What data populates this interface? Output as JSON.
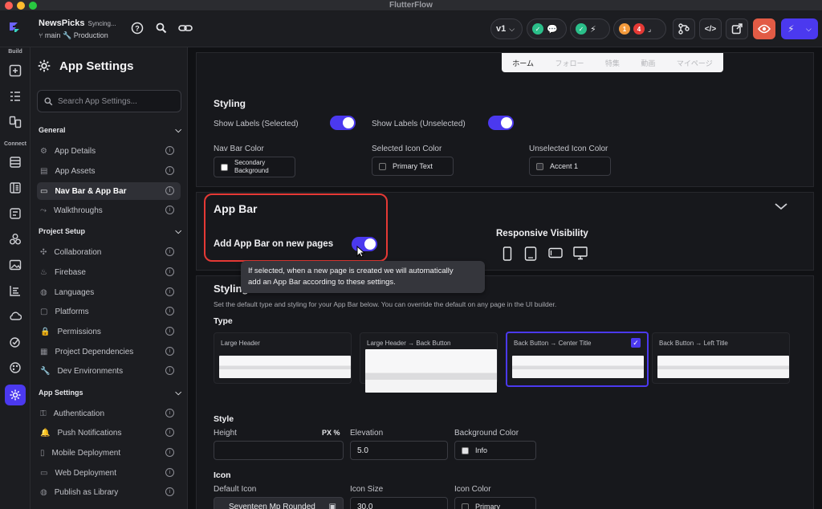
{
  "window": {
    "title": "FlutterFlow",
    "dots": [
      "#ff5f57",
      "#febc2e",
      "#28c840"
    ]
  },
  "topbar": {
    "project_name": "NewsPicks",
    "sync_status": "Syncing...",
    "branch": "main",
    "environment": "Production",
    "version": "v1",
    "warnings_count": "1",
    "errors_count": "4"
  },
  "rail": {
    "build_label": "Build",
    "connect_label": "Connect"
  },
  "settings": {
    "title": "App Settings",
    "search_placeholder": "Search App Settings...",
    "groups": [
      {
        "label": "General",
        "items": [
          "App Details",
          "App Assets",
          "Nav Bar & App Bar",
          "Walkthroughs"
        ]
      },
      {
        "label": "Project Setup",
        "items": [
          "Collaboration",
          "Firebase",
          "Languages",
          "Platforms",
          "Permissions",
          "Project Dependencies",
          "Dev Environments"
        ]
      },
      {
        "label": "App Settings",
        "items": [
          "Authentication",
          "Push Notifications",
          "Mobile Deployment",
          "Web Deployment",
          "Publish as Library"
        ]
      }
    ],
    "active_item": "Nav Bar & App Bar"
  },
  "main": {
    "preview_tabs": [
      "ホーム",
      "フォロー",
      "特集",
      "動画",
      "マイページ"
    ],
    "nav_styling": {
      "heading": "Styling",
      "show_labels_selected": "Show Labels (Selected)",
      "show_labels_unselected": "Show Labels (Unselected)",
      "nav_bar_color_label": "Nav Bar Color",
      "nav_bar_color_value": "Secondary Background",
      "selected_icon_color_label": "Selected Icon Color",
      "selected_icon_color_value": "Primary Text",
      "unselected_icon_color_label": "Unselected Icon Color",
      "unselected_icon_color_value": "Accent 1"
    },
    "app_bar": {
      "heading": "App Bar",
      "add_app_bar_label": "Add App Bar on new pages",
      "add_app_bar_enabled": true,
      "responsive_visibility": "Responsive Visibility",
      "tooltip_line1": "If selected, when a new page is created we will automatically",
      "tooltip_line2": "add an App Bar according to these settings."
    },
    "app_bar_styling": {
      "heading": "Styling",
      "description": "Set the default type and styling for your App Bar below. You can override the default on any page in the UI builder.",
      "type_label": "Type",
      "types": [
        "Large Header",
        "Large Header → Back Button",
        "Back Button → Center Title",
        "Back Button → Left Title"
      ],
      "selected_type": "Back Button → Center Title",
      "style_label": "Style",
      "height_label": "Height",
      "height_units": "PX %",
      "elevation_label": "Elevation",
      "elevation_value": "5.0",
      "bg_color_label": "Background Color",
      "bg_color_value": "Info",
      "icon_label": "Icon",
      "default_icon_label": "Default Icon",
      "default_icon_value": "Seventeen Mp Rounded",
      "icon_size_label": "Icon Size",
      "icon_size_value": "30.0",
      "icon_color_label": "Icon Color",
      "icon_color_value": "Primary"
    }
  },
  "colors": {
    "accent": "#4b39ef",
    "highlight": "#e53935",
    "bg": "#141518",
    "panel": "#1c1d21"
  }
}
